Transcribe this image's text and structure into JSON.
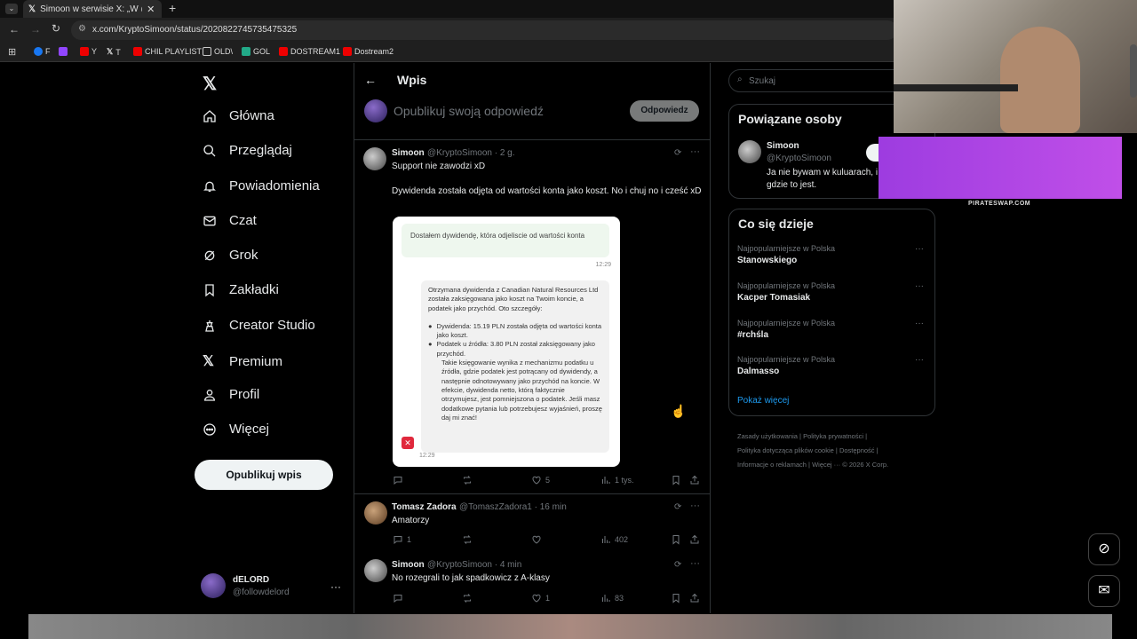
{
  "browser": {
    "tab_title": "Simoon w serwisie X: „W @xtb",
    "url": "x.com/KryptoSimoon/status/2020822745735475325",
    "bookmarks": [
      "F",
      "Y",
      "T",
      "CHIL PLAYLIST",
      "OLD\\",
      "GOL",
      "DOSTREAM1",
      "Dostream2"
    ]
  },
  "sidebar": {
    "items": [
      {
        "label": "Główna",
        "icon": "home-icon"
      },
      {
        "label": "Przeglądaj",
        "icon": "search-icon"
      },
      {
        "label": "Powiadomienia",
        "icon": "bell-icon"
      },
      {
        "label": "Czat",
        "icon": "mail-icon"
      },
      {
        "label": "Grok",
        "icon": "grok-icon"
      },
      {
        "label": "Zakładki",
        "icon": "bookmark-icon"
      },
      {
        "label": "Creator Studio",
        "icon": "creator-icon"
      },
      {
        "label": "Premium",
        "icon": "x-icon"
      },
      {
        "label": "Profil",
        "icon": "person-icon"
      },
      {
        "label": "Więcej",
        "icon": "more-circle-icon"
      }
    ],
    "post_button": "Opublikuj wpis",
    "account": {
      "name": "dELORD",
      "handle": "@followdelord"
    }
  },
  "main": {
    "header_title": "Wpis",
    "reply_placeholder": "Opublikuj swoją odpowiedź",
    "reply_button": "Odpowiedz",
    "post": {
      "name": "Simoon",
      "handle": "@KryptoSimoon · 2 g.",
      "line1": "Support nie zawodzi xD",
      "line2": "Dywidenda została odjęta od wartości konta jako koszt. No i chuj no i cześć xD",
      "image": {
        "bubble_user": "Dostałem dywidendę, która odjeliscie od wartości konta",
        "time1": "12:29",
        "reply_intro": "Otrzymana dywidenda z Canadian Natural Resources Ltd została zaksięgowana jako koszt na Twoim koncie, a podatek jako przychód. Oto szczegóły:",
        "bullet1": "Dywidenda: 15.19 PLN została odjęta od wartości konta jako koszt.",
        "bullet2": "Podatek u źródła: 3.80 PLN został zaksięgowany jako przychód.",
        "reply_rest": "Takie księgowanie wynika z mechanizmu podatku u źródła, gdzie podatek jest potrącany od dywidendy, a następnie odnotowywany jako przychód na koncie. W efekcie, dywidenda netto, którą faktycznie otrzymujesz, jest pomniejszona o podatek. Jeśli masz dodatkowe pytania lub potrzebujesz wyjaśnień, proszę daj mi znać!",
        "time2": "12:29"
      },
      "likes": "5",
      "views": "1 tys."
    },
    "replies": [
      {
        "name": "Tomasz Zadora",
        "handle": "@TomaszZadora1 · 16 min",
        "text": "Amatorzy",
        "comments": "1",
        "likes": "",
        "views": "402"
      },
      {
        "name": "Simoon",
        "handle": "@KryptoSimoon · 4 min",
        "text": "No rozegrali to jak spadkowicz z A-klasy",
        "comments": "",
        "likes": "1",
        "views": "83"
      }
    ]
  },
  "right": {
    "search_placeholder": "Szukaj",
    "related_title": "Powiązane osoby",
    "related_user": {
      "name": "Simoon",
      "handle": "@KryptoSimoon",
      "bio": "Ja nie bywam w kuluarach, i gdzie to jest."
    },
    "trends_title": "Co się dzieje",
    "trends": [
      {
        "context": "Najpopularniejsze w Polska",
        "name": "Stanowskiego"
      },
      {
        "context": "Najpopularniejsze w Polska",
        "name": "Kacper Tomasiak"
      },
      {
        "context": "Najpopularniejsze w Polska",
        "name": "#rchśla"
      },
      {
        "context": "Najpopularniejsze w Polska",
        "name": "Dalmasso"
      }
    ],
    "show_more": "Pokaż więcej",
    "footer": [
      "Zasady użytkowania",
      "Polityka prywatności",
      "Polityka dotycząca plików cookie",
      "Dostępność",
      "Informacje o reklamach",
      "Więcej ···",
      "© 2026 X Corp."
    ]
  },
  "overlay": {
    "banner_label": "PIRATESWAP.COM"
  }
}
